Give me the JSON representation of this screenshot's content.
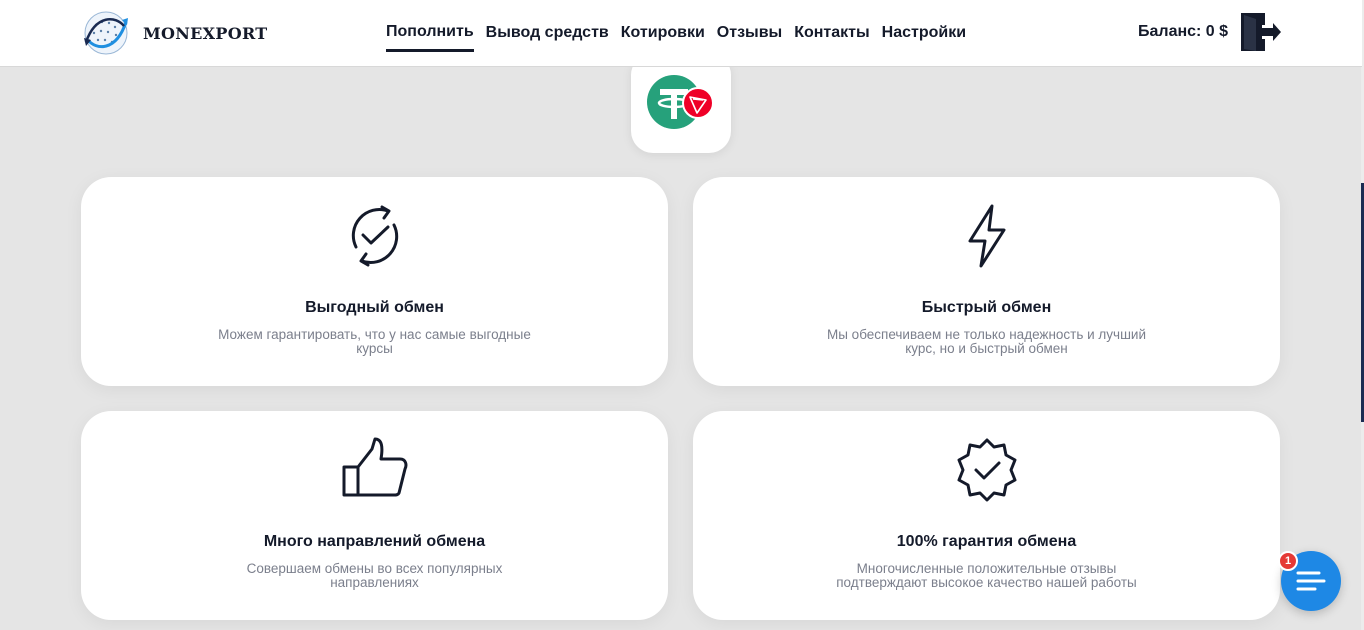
{
  "header": {
    "logo_text": "MONEXPORT",
    "nav": [
      {
        "label": "Пополнить",
        "active": true
      },
      {
        "label": "Вывод средств",
        "active": false
      },
      {
        "label": "Котировки",
        "active": false
      },
      {
        "label": "Отзывы",
        "active": false
      },
      {
        "label": "Контакты",
        "active": false
      },
      {
        "label": "Настройки",
        "active": false
      }
    ],
    "balance": "Баланс: 0 $",
    "logout_icon": "logout-door-icon"
  },
  "coin_icon": "usdt-trc20-icon",
  "features": [
    {
      "icon": "refresh-check-icon",
      "title": "Выгодный обмен",
      "desc": "Можем гарантировать, что у нас самые выгодные курсы"
    },
    {
      "icon": "lightning-icon",
      "title": "Быстрый обмен",
      "desc": "Мы обеспечиваем не только надежность и лучший курс, но и быстрый обмен"
    },
    {
      "icon": "thumbs-up-icon",
      "title": "Много направлений обмена",
      "desc": "Совершаем обмены во всех популярных направлениях"
    },
    {
      "icon": "verified-badge-icon",
      "title": "100% гарантия обмена",
      "desc": "Многочисленные положительные отзывы подтверждают высокое качество нашей работы"
    }
  ],
  "chat": {
    "badge_count": "1",
    "icon": "chat-lines-icon"
  },
  "colors": {
    "accent": "#1e88e5",
    "text": "#141a2a",
    "muted": "#7b7f8c",
    "badge": "#e53935",
    "background": "#e5e5e5"
  }
}
